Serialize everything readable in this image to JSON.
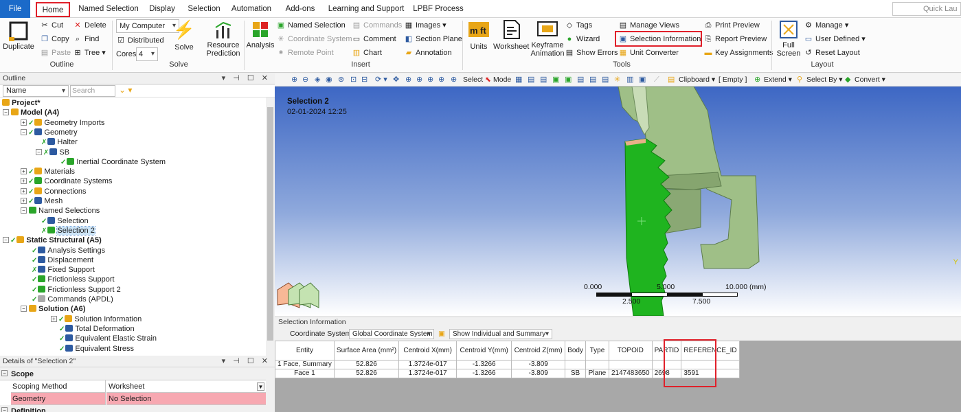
{
  "tabs": [
    "File",
    "Home",
    "Named Selection",
    "Display",
    "Selection",
    "Automation",
    "Add-ons",
    "Learning and Support",
    "LPBF Process"
  ],
  "quick_launch": "Quick Lau",
  "ribbon": {
    "outline": {
      "duplicate": "Duplicate",
      "cut": "Cut",
      "delete": "Delete",
      "copy": "Copy",
      "find": "Find",
      "paste": "Paste",
      "tree": "Tree",
      "label": "Outline"
    },
    "solve": {
      "env": "My Computer",
      "distributed": "Distributed",
      "cores_label": "Cores",
      "cores_value": "4",
      "solve": "Solve",
      "resource_prediction_1": "Resource",
      "resource_prediction_2": "Prediction",
      "label": "Solve"
    },
    "insert": {
      "analysis": "Analysis",
      "named_selection": "Named Selection",
      "commands": "Commands",
      "images": "Images",
      "coordinate_system": "Coordinate System",
      "comment": "Comment",
      "section_plane": "Section Plane",
      "remote_point": "Remote Point",
      "chart": "Chart",
      "annotation": "Annotation",
      "label": "Insert"
    },
    "tools": {
      "units": "Units",
      "worksheet": "Worksheet",
      "keyframe_1": "Keyframe",
      "keyframe_2": "Animation",
      "tags": "Tags",
      "wizard": "Wizard",
      "show_errors": "Show Errors",
      "manage_views": "Manage Views",
      "selection_information": "Selection Information",
      "unit_converter": "Unit Converter",
      "print_preview": "Print Preview",
      "report_preview": "Report Preview",
      "key_assignments": "Key Assignments",
      "label": "Tools"
    },
    "layout": {
      "full_screen_1": "Full",
      "full_screen_2": "Screen",
      "manage": "Manage",
      "user_defined": "User Defined",
      "reset_layout": "Reset Layout",
      "label": "Layout"
    }
  },
  "outline": {
    "title": "Outline",
    "filter": "Name",
    "search_placeholder": "Search Outline",
    "nodes": [
      {
        "label": "Project*",
        "bold": true
      },
      {
        "label": "Model (A4)",
        "bold": true
      },
      {
        "label": "Geometry Imports"
      },
      {
        "label": "Geometry"
      },
      {
        "label": "Halter"
      },
      {
        "label": "SB"
      },
      {
        "label": "Inertial Coordinate System"
      },
      {
        "label": "Materials"
      },
      {
        "label": "Coordinate Systems"
      },
      {
        "label": "Connections"
      },
      {
        "label": "Mesh"
      },
      {
        "label": "Named Selections"
      },
      {
        "label": "Selection"
      },
      {
        "label": "Selection 2"
      },
      {
        "label": "Static Structural (A5)",
        "bold": true
      },
      {
        "label": "Analysis Settings"
      },
      {
        "label": "Displacement"
      },
      {
        "label": "Fixed Support"
      },
      {
        "label": "Frictionless Support"
      },
      {
        "label": "Frictionless Support 2"
      },
      {
        "label": "Commands (APDL)"
      },
      {
        "label": "Solution (A6)",
        "bold": true
      },
      {
        "label": "Solution Information"
      },
      {
        "label": "Total Deformation"
      },
      {
        "label": "Equivalent Elastic Strain"
      },
      {
        "label": "Equivalent Stress"
      }
    ]
  },
  "details": {
    "title": "Details of \"Selection 2\"",
    "scope_header": "Scope",
    "rows": [
      {
        "label": "Scoping Method",
        "value": "Worksheet"
      },
      {
        "label": "Geometry",
        "value": "No Selection"
      }
    ],
    "definition_header": "Definition"
  },
  "graphics_toolbar": {
    "select": "Select",
    "mode": "Mode",
    "clipboard": "Clipboard",
    "empty": "[ Empty ]",
    "extend": "Extend",
    "select_by": "Select By",
    "convert": "Convert"
  },
  "viewport": {
    "title": "Selection 2",
    "date": "02-01-2024 12:25",
    "axis_label": "Y",
    "scale_labels_top": [
      "0.000",
      "5.000",
      "10.000 (mm)"
    ],
    "scale_labels_bottom": [
      "2.500",
      "7.500"
    ]
  },
  "selection_info": {
    "title": "Selection Information",
    "coord_label": "Coordinate System:",
    "coord_value": "Global Coordinate System",
    "show_value": "Show Individual and Summary",
    "headers": [
      "Entity",
      "Surface Area (mm²)",
      "Centroid X(mm)",
      "Centroid Y(mm)",
      "Centroid Z(mm)",
      "Body",
      "Type",
      "TOPOID",
      "PARTID",
      "REFERENCE_ID"
    ],
    "rows": [
      [
        "1 Face, Summary",
        "52.826",
        "1.3724e-017",
        "-1.3266",
        "-3.809",
        "",
        "",
        "",
        "",
        ""
      ],
      [
        "Face 1",
        "52.826",
        "1.3724e-017",
        "-1.3266",
        "-3.809",
        "SB",
        "Plane",
        "2147483650",
        "2698",
        "3591"
      ]
    ]
  },
  "colors": {
    "accent": "#1b6ac9",
    "highlight_box": "#e0202a",
    "selected_face": "#1fb41f",
    "part_body": "#9fbf87"
  }
}
